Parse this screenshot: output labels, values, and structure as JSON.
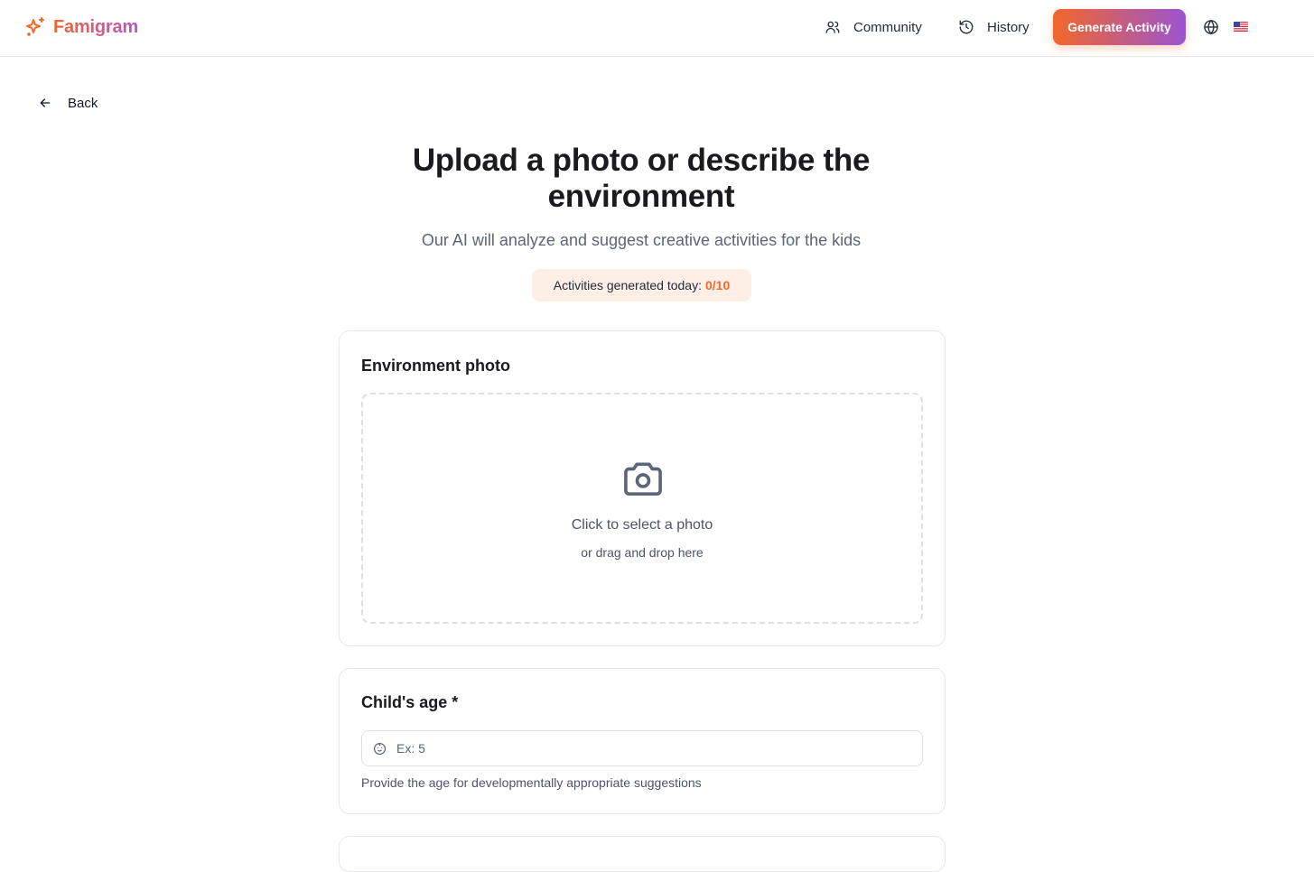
{
  "header": {
    "brand": "Famigram",
    "nav": {
      "community": "Community",
      "history": "History"
    },
    "generate_button": "Generate Activity",
    "language_icon": "globe-icon",
    "flag": "us-flag"
  },
  "back": {
    "label": "Back"
  },
  "hero": {
    "title": "Upload a photo or describe the environment",
    "subtitle": "Our AI will analyze and suggest creative activities for the kids",
    "quota_label": "Activities generated today:",
    "quota_value": "0/10"
  },
  "photo_card": {
    "title": "Environment photo",
    "dropzone_main": "Click to select a photo",
    "dropzone_sub": "or drag and drop here"
  },
  "age_card": {
    "title": "Child's age *",
    "placeholder": "Ex: 5",
    "value": "",
    "helper": "Provide the age for developmentally appropriate suggestions"
  },
  "colors": {
    "accent_orange": "#f2672a",
    "accent_purple": "#9b54d1",
    "quota_bg": "#fdeee6"
  }
}
